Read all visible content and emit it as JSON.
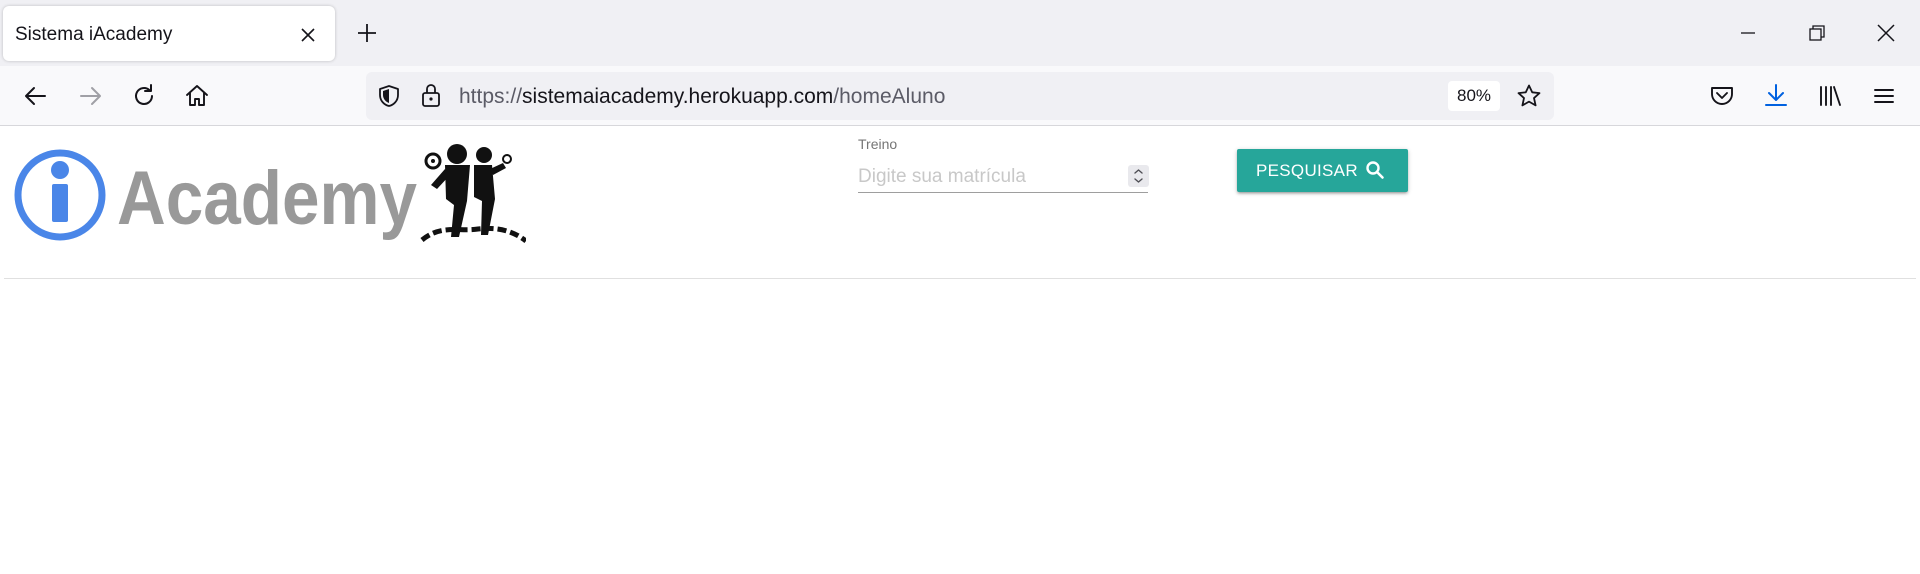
{
  "browser": {
    "tab": {
      "title": "Sistema iAcademy",
      "close_icon": "close-icon"
    },
    "new_tab_icon": "plus-icon",
    "window_controls": [
      "minimize-icon",
      "restore-icon",
      "close-window-icon"
    ],
    "nav": {
      "back_icon": "back-arrow-icon",
      "forward_icon": "forward-arrow-icon",
      "reload_icon": "reload-icon",
      "home_icon": "home-icon"
    },
    "url": {
      "scheme": "https://",
      "host": "sistemaiacademy.herokuapp.com",
      "path": "/homeAluno",
      "zoom": "80%"
    },
    "toolbar_icons": [
      "pocket-icon",
      "download-icon",
      "library-icon",
      "menu-icon"
    ],
    "colors": {
      "download_icon": "#0061e0",
      "tab_strip": "#f0f0f4",
      "nav_bar": "#f9f9fb"
    }
  },
  "page": {
    "logo": {
      "text": "Academy",
      "letter": "i"
    },
    "search": {
      "label": "Treino",
      "placeholder": "Digite sua matrícula",
      "value": ""
    },
    "search_button": {
      "label": "PESQUISAR",
      "icon": "search-icon"
    },
    "colors": {
      "accent": "#26a69a",
      "logo_blue": "#4a86e8",
      "logo_gray": "#999999"
    }
  }
}
